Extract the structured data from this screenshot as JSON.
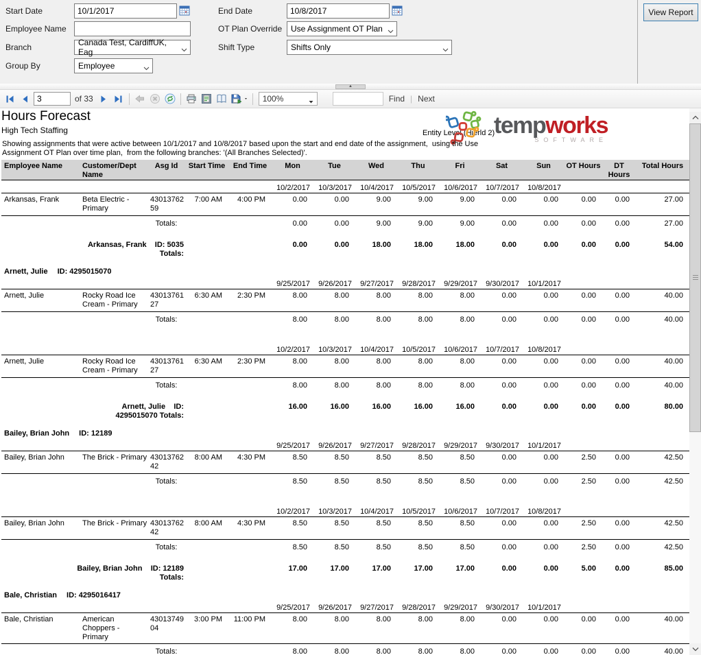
{
  "params": {
    "start_date": {
      "label": "Start Date",
      "value": "10/1/2017"
    },
    "end_date": {
      "label": "End Date",
      "value": "10/8/2017"
    },
    "employee_name": {
      "label": "Employee Name",
      "value": ""
    },
    "ot_plan": {
      "label": "OT Plan Override",
      "value": "Use Assignment OT Plan"
    },
    "branch": {
      "label": "Branch",
      "value": "Canada Test, CardiffUK, Eag"
    },
    "shift_type": {
      "label": "Shift Type",
      "value": "Shifts Only"
    },
    "group_by": {
      "label": "Group By",
      "value": "Employee"
    },
    "view_report_label": "View Report"
  },
  "toolbar": {
    "page_current": "3",
    "of_pages": "of 33",
    "zoom_value": "100%",
    "find_label": "Find",
    "next_label": "Next",
    "icons": [
      "first-page",
      "previous-page",
      "next-page",
      "last-page",
      "back",
      "stop",
      "refresh",
      "print",
      "print-layout",
      "page-setup",
      "export",
      "zoom-dropdown",
      "find-text"
    ]
  },
  "report": {
    "title": "Hours Forecast",
    "subtitle": "High Tech Staffing",
    "entity_level": "Entity Level (Hierld 2)",
    "description_line1": "Showing assignments that were active between 10/1/2017 and 10/8/2017 based upon the start and end date of the assignment,  using the Use",
    "description_line2": "Assignment OT Plan over time plan,  from the following branches: '(All Branches Selected)'.",
    "logo": {
      "brand_temp": "temp",
      "brand_works": "works",
      "brand_sub": "SOFTWARE"
    }
  },
  "table": {
    "headers": [
      "Employee Name",
      "Customer/Dept Name",
      "Asg Id",
      "Start Time",
      "End Time",
      "Mon",
      "Tue",
      "Wed",
      "Thu",
      "Fri",
      "Sat",
      "Sun",
      "OT Hours",
      "DT Hours",
      "Total Hours"
    ],
    "rows": [
      {
        "type": "dates",
        "dates": [
          "10/2/2017",
          "10/3/2017",
          "10/4/2017",
          "10/5/2017",
          "10/6/2017",
          "10/7/2017",
          "10/8/2017"
        ]
      },
      {
        "type": "data",
        "employee": "Arkansas, Frank",
        "customer": "Beta Electric - Primary",
        "asg_id": "43013762 59",
        "start": "7:00 AM",
        "end": "4:00 PM",
        "days": [
          "0.00",
          "0.00",
          "9.00",
          "9.00",
          "9.00",
          "0.00",
          "0.00"
        ],
        "ot": "0.00",
        "dt": "0.00",
        "total": "27.00"
      },
      {
        "type": "totals",
        "label": "Totals:",
        "days": [
          "0.00",
          "0.00",
          "9.00",
          "9.00",
          "9.00",
          "0.00",
          "0.00"
        ],
        "ot": "0.00",
        "dt": "0.00",
        "total": "27.00"
      },
      {
        "type": "spacer",
        "size": "md"
      },
      {
        "type": "grouptotal",
        "line1": "Arkansas, Frank    ID: 5035",
        "line2": "Totals:",
        "days": [
          "0.00",
          "0.00",
          "18.00",
          "18.00",
          "18.00",
          "0.00",
          "0.00"
        ],
        "ot": "0.00",
        "dt": "0.00",
        "total": "54.00"
      },
      {
        "type": "spacer",
        "size": "sm"
      },
      {
        "type": "groupheader",
        "name": "Arnett, Julie",
        "id": "ID: 4295015070"
      },
      {
        "type": "dates",
        "dates": [
          "9/25/2017",
          "9/26/2017",
          "9/27/2017",
          "9/28/2017",
          "9/29/2017",
          "9/30/2017",
          "10/1/2017"
        ]
      },
      {
        "type": "data",
        "employee": "Arnett, Julie",
        "customer": "Rocky Road Ice Cream  - Primary",
        "asg_id": "43013761 27",
        "start": "6:30 AM",
        "end": "2:30 PM",
        "days": [
          "8.00",
          "8.00",
          "8.00",
          "8.00",
          "8.00",
          "0.00",
          "0.00"
        ],
        "ot": "0.00",
        "dt": "0.00",
        "total": "40.00"
      },
      {
        "type": "totals",
        "label": "Totals:",
        "days": [
          "8.00",
          "8.00",
          "8.00",
          "8.00",
          "8.00",
          "0.00",
          "0.00"
        ],
        "ot": "0.00",
        "dt": "0.00",
        "total": "40.00"
      },
      {
        "type": "spacer",
        "size": "lg"
      },
      {
        "type": "dates",
        "dates": [
          "10/2/2017",
          "10/3/2017",
          "10/4/2017",
          "10/5/2017",
          "10/6/2017",
          "10/7/2017",
          "10/8/2017"
        ]
      },
      {
        "type": "data",
        "employee": "Arnett, Julie",
        "customer": "Rocky Road Ice Cream  - Primary",
        "asg_id": "43013761 27",
        "start": "6:30 AM",
        "end": "2:30 PM",
        "days": [
          "8.00",
          "8.00",
          "8.00",
          "8.00",
          "8.00",
          "0.00",
          "0.00"
        ],
        "ot": "0.00",
        "dt": "0.00",
        "total": "40.00"
      },
      {
        "type": "totals",
        "label": "Totals:",
        "days": [
          "8.00",
          "8.00",
          "8.00",
          "8.00",
          "8.00",
          "0.00",
          "0.00"
        ],
        "ot": "0.00",
        "dt": "0.00",
        "total": "40.00"
      },
      {
        "type": "spacer",
        "size": "md"
      },
      {
        "type": "grouptotal",
        "line1": "Arnett, Julie    ID:",
        "line2": "4295015070 Totals:",
        "days": [
          "16.00",
          "16.00",
          "16.00",
          "16.00",
          "16.00",
          "0.00",
          "0.00"
        ],
        "ot": "0.00",
        "dt": "0.00",
        "total": "80.00"
      },
      {
        "type": "spacer",
        "size": "sm"
      },
      {
        "type": "groupheader",
        "name": "Bailey, Brian John",
        "id": "ID: 12189"
      },
      {
        "type": "dates",
        "dates": [
          "9/25/2017",
          "9/26/2017",
          "9/27/2017",
          "9/28/2017",
          "9/29/2017",
          "9/30/2017",
          "10/1/2017"
        ]
      },
      {
        "type": "data",
        "employee": "Bailey, Brian John",
        "customer": "The Brick - Primary",
        "asg_id": "43013762 42",
        "start": "8:00 AM",
        "end": "4:30 PM",
        "days": [
          "8.50",
          "8.50",
          "8.50",
          "8.50",
          "8.50",
          "0.00",
          "0.00"
        ],
        "ot": "2.50",
        "dt": "0.00",
        "total": "42.50"
      },
      {
        "type": "totals",
        "label": "Totals:",
        "days": [
          "8.50",
          "8.50",
          "8.50",
          "8.50",
          "8.50",
          "0.00",
          "0.00"
        ],
        "ot": "2.50",
        "dt": "0.00",
        "total": "42.50"
      },
      {
        "type": "spacer",
        "size": "lg"
      },
      {
        "type": "dates",
        "dates": [
          "10/2/2017",
          "10/3/2017",
          "10/4/2017",
          "10/5/2017",
          "10/6/2017",
          "10/7/2017",
          "10/8/2017"
        ]
      },
      {
        "type": "data",
        "employee": "Bailey, Brian John",
        "customer": "The Brick - Primary",
        "asg_id": "43013762 42",
        "start": "8:00 AM",
        "end": "4:30 PM",
        "days": [
          "8.50",
          "8.50",
          "8.50",
          "8.50",
          "8.50",
          "0.00",
          "0.00"
        ],
        "ot": "2.50",
        "dt": "0.00",
        "total": "42.50"
      },
      {
        "type": "totals",
        "label": "Totals:",
        "days": [
          "8.50",
          "8.50",
          "8.50",
          "8.50",
          "8.50",
          "0.00",
          "0.00"
        ],
        "ot": "2.50",
        "dt": "0.00",
        "total": "42.50"
      },
      {
        "type": "spacer",
        "size": "md"
      },
      {
        "type": "grouptotal",
        "line1": "Bailey, Brian John    ID: 12189",
        "line2": "Totals:",
        "days": [
          "17.00",
          "17.00",
          "17.00",
          "17.00",
          "17.00",
          "0.00",
          "0.00"
        ],
        "ot": "5.00",
        "dt": "0.00",
        "total": "85.00"
      },
      {
        "type": "spacer",
        "size": "sm"
      },
      {
        "type": "groupheader",
        "name": "Bale, Christian",
        "id": "ID: 4295016417"
      },
      {
        "type": "dates",
        "dates": [
          "9/25/2017",
          "9/26/2017",
          "9/27/2017",
          "9/28/2017",
          "9/29/2017",
          "9/30/2017",
          "10/1/2017"
        ]
      },
      {
        "type": "data",
        "employee": "Bale, Christian",
        "customer": "American Choppers - Primary",
        "asg_id": "43013749 04",
        "start": "3:00 PM",
        "end": "11:00 PM",
        "days": [
          "8.00",
          "8.00",
          "8.00",
          "8.00",
          "8.00",
          "0.00",
          "0.00"
        ],
        "ot": "0.00",
        "dt": "0.00",
        "total": "40.00"
      },
      {
        "type": "totals",
        "label": "Totals:",
        "days": [
          "8.00",
          "8.00",
          "8.00",
          "8.00",
          "8.00",
          "0.00",
          "0.00"
        ],
        "ot": "0.00",
        "dt": "0.00",
        "total": "40.00"
      }
    ]
  }
}
